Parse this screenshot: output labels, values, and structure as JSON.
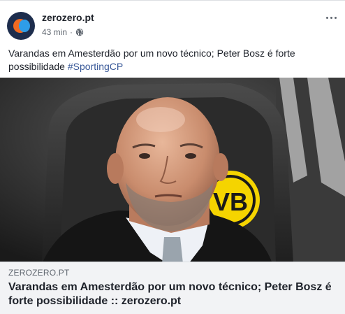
{
  "post": {
    "page_name": "zerozero.pt",
    "timestamp": "43 min",
    "separator": "·",
    "text": "Varandas em Amesterdão por um novo técnico; Peter Bosz é forte possibilidade ",
    "hashtag": "#SportingCP"
  },
  "link_preview": {
    "domain": "ZEROZERO.PT",
    "title": "Varandas em Amesterdão por um novo técnico; Peter Bosz é forte possibilidade :: zerozero.pt"
  },
  "colors": {
    "brand_dark": "#1d2d4d",
    "brand_orange": "#f26a21",
    "brand_blue": "#2e9de8",
    "link_blue": "#385898",
    "bvb_yellow": "#f5d400"
  },
  "icons": {
    "privacy": "globe-icon",
    "menu": "more-options-icon"
  }
}
